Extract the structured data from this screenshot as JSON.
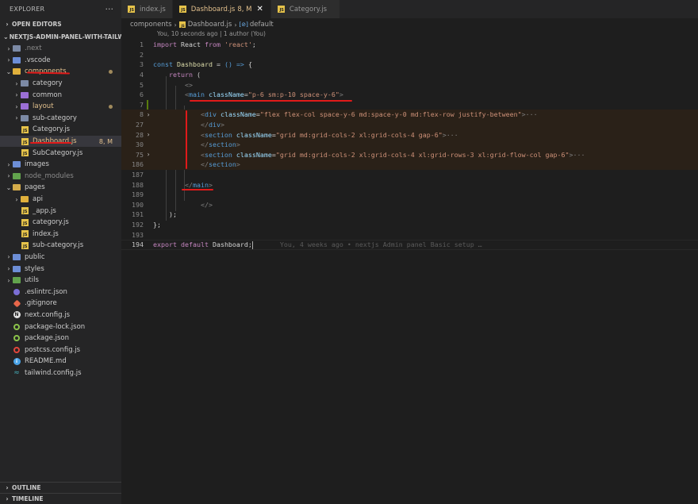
{
  "sidebar": {
    "title": "EXPLORER",
    "more": "···",
    "open_editors": "OPEN EDITORS",
    "project": "NEXTJS-ADMIN-PANEL-WITH-TAILWI...",
    "items": [
      {
        "label": ".next",
        "icon": "folder-icon",
        "dim": true
      },
      {
        "label": ".vscode",
        "icon": "folder-icon"
      },
      {
        "label": "components",
        "icon": "folder-open-icon",
        "open": true,
        "modified": true
      },
      {
        "label": "category",
        "icon": "folder-icon"
      },
      {
        "label": "common",
        "icon": "folder-icon"
      },
      {
        "label": "layout",
        "icon": "folder-icon"
      },
      {
        "label": "sub-category",
        "icon": "folder-icon"
      },
      {
        "label": "Category.js",
        "icon": "js-file-icon"
      },
      {
        "label": "Dashboard.js",
        "icon": "js-file-icon",
        "badge": "8, M"
      },
      {
        "label": "SubCategory.js",
        "icon": "js-file-icon"
      },
      {
        "label": "images",
        "icon": "folder-icon"
      },
      {
        "label": "node_modules",
        "icon": "folder-icon",
        "dim": true
      },
      {
        "label": "pages",
        "icon": "folder-open-icon"
      },
      {
        "label": "api",
        "icon": "folder-icon"
      },
      {
        "label": "_app.js",
        "icon": "js-file-icon"
      },
      {
        "label": "category.js",
        "icon": "js-file-icon"
      },
      {
        "label": "index.js",
        "icon": "js-file-icon"
      },
      {
        "label": "sub-category.js",
        "icon": "js-file-icon"
      },
      {
        "label": "public",
        "icon": "folder-icon"
      },
      {
        "label": "styles",
        "icon": "folder-icon"
      },
      {
        "label": "utils",
        "icon": "folder-icon"
      },
      {
        "label": ".eslintrc.json",
        "icon": "eslint-icon"
      },
      {
        "label": ".gitignore",
        "icon": "git-icon"
      },
      {
        "label": "next.config.js",
        "icon": "next-icon"
      },
      {
        "label": "package-lock.json",
        "icon": "npm-icon"
      },
      {
        "label": "package.json",
        "icon": "npm-icon"
      },
      {
        "label": "postcss.config.js",
        "icon": "postcss-icon"
      },
      {
        "label": "README.md",
        "icon": "info-icon"
      },
      {
        "label": "tailwind.config.js",
        "icon": "tailwind-icon"
      }
    ],
    "outline": "OUTLINE",
    "timeline": "TIMELINE"
  },
  "tabs": [
    {
      "label": "index.js",
      "meta": "",
      "active": false
    },
    {
      "label": "Dashboard.js",
      "meta": "8, M",
      "active": true,
      "close": "✕"
    },
    {
      "label": "Category.js",
      "meta": "",
      "active": false
    }
  ],
  "breadcrumb": {
    "folder": "components",
    "file": "Dashboard.js",
    "symbol_icon": "[⊘]",
    "symbol": "default"
  },
  "editor": {
    "codelens": "You, 10 seconds ago | 1 author (You)",
    "blame": "You, 4 weeks ago • nextjs Admin panel Basic setup …",
    "lines": {
      "l1": "1",
      "l2": "2",
      "l3": "3",
      "l4": "4",
      "l5": "5",
      "l6": "6",
      "l7": "7",
      "l8": "8",
      "l27": "27",
      "l28": "28",
      "l30": "30",
      "l75": "75",
      "l186": "186",
      "l187": "187",
      "l188": "188",
      "l189": "189",
      "l190": "190",
      "l191": "191",
      "l192": "192",
      "l193": "193",
      "l194": "194"
    },
    "code": {
      "import": "import",
      "react": "React",
      "from": "from",
      "react_str": "'react'",
      "const": "const",
      "dashboard": "Dashboard",
      "arrow": "() =>",
      "return": "return",
      "main_open_attr": "className",
      "main_class": "\"p-6 sm:p-10 space-y-6\"",
      "div_class": "\"flex flex-col space-y-6 md:space-y-0 md:flex-row justify-between\"",
      "section1_class": "\"grid md:grid-cols-2 xl:grid-cols-4 gap-6\"",
      "section2_class": "\"grid md:grid-cols-2 xl:grid-cols-4 xl:grid-rows-3 xl:grid-flow-col gap-6\"",
      "export": "export",
      "default": "default"
    }
  },
  "colors": {
    "accent_annotation": "#e01a1a",
    "modified": "#e2c08d",
    "git_added": "#587c0c"
  }
}
